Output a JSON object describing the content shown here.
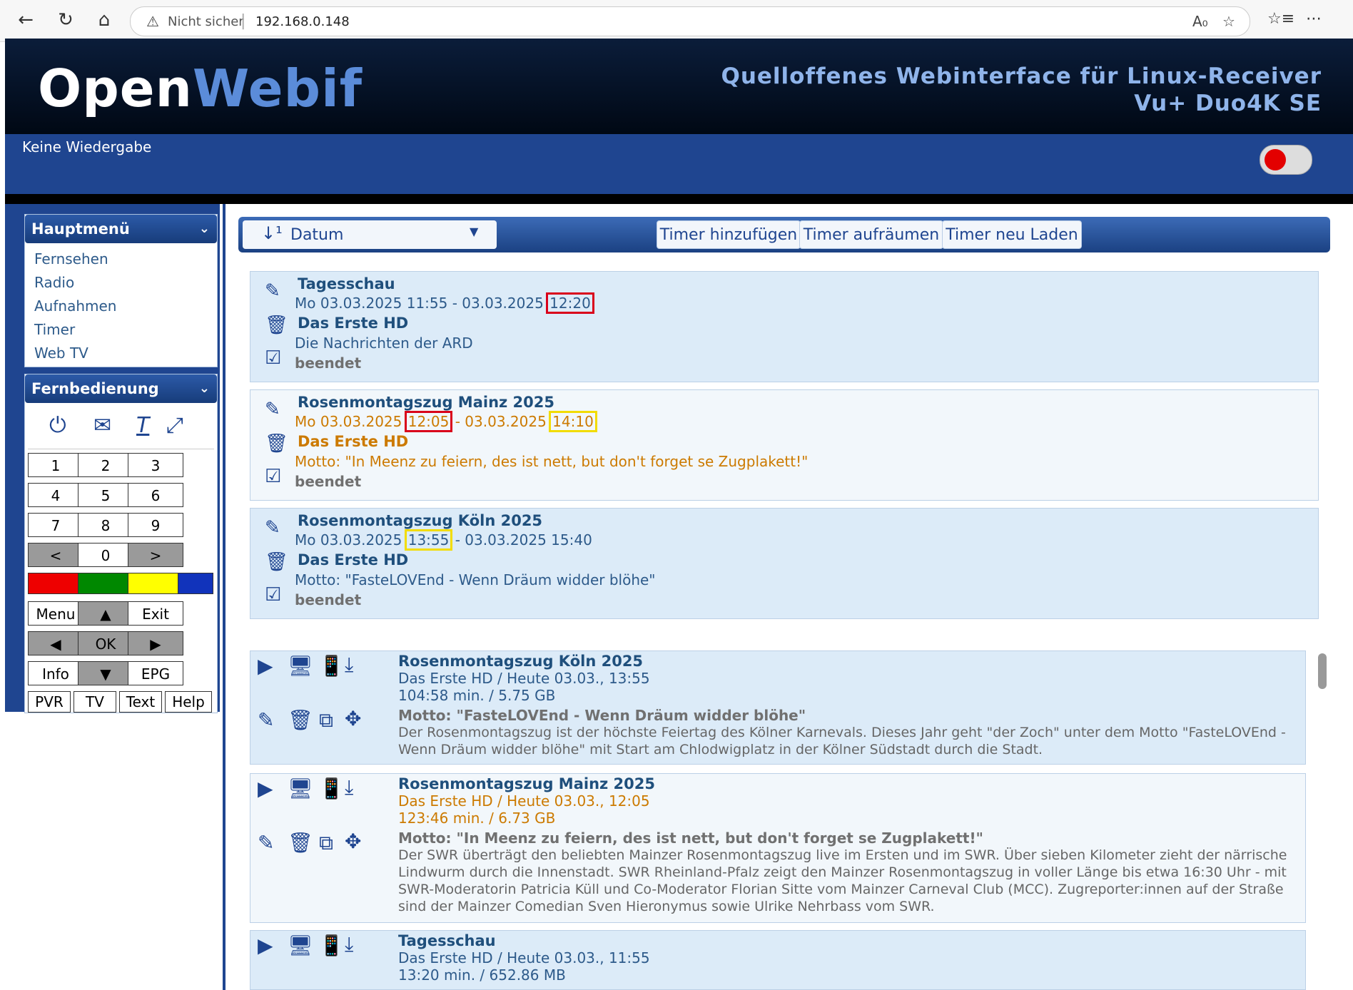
{
  "browser": {
    "warning": "Nicht sicher",
    "url": "192.168.0.148"
  },
  "header": {
    "logo_open": "Open",
    "logo_webif": "Webif",
    "tagline_1": "Quelloffenes Webinterface für Linux-Receiver",
    "tagline_2": "Vu+ Duo4K SE",
    "playback": "Keine Wiedergabe"
  },
  "sidebar": {
    "main_menu_title": "Hauptmenü",
    "main_menu": [
      "Fernsehen",
      "Radio",
      "Aufnahmen",
      "Timer",
      "Web TV"
    ],
    "remote_title": "Fernbedienung",
    "remote_keys": {
      "k1": "1",
      "k2": "2",
      "k3": "3",
      "k4": "4",
      "k5": "5",
      "k6": "6",
      "k7": "7",
      "k8": "8",
      "k9": "9",
      "prev": "<",
      "k0": "0",
      "next": ">",
      "menu": "Menu",
      "up": "▲",
      "exit": "Exit",
      "left": "◀",
      "ok": "OK",
      "right": "▶",
      "info": "Info",
      "down": "▼",
      "epg": "EPG",
      "pvr": "PVR",
      "tv": "TV",
      "text": "Text",
      "help": "Help"
    },
    "color_keys": [
      "#ee0000",
      "#008800",
      "#ffff00",
      "#1133bb"
    ]
  },
  "toolbar": {
    "sort_label": "Datum",
    "add": "Timer hinzufügen",
    "cleanup": "Timer aufräumen",
    "reload": "Timer neu Laden"
  },
  "timers": [
    {
      "title": "Tagesschau",
      "time_prefix": "Mo 03.03.2025 11:55 - 03.03.2025 ",
      "time_end": "12:20",
      "channel": "Das Erste HD",
      "desc": "Die Nachrichten der ARD",
      "status": "beendet"
    },
    {
      "title": "Rosenmontagszug Mainz 2025",
      "time_a": "Mo 03.03.2025 ",
      "time_start": "12:05",
      "time_b": " - 03.03.2025 ",
      "time_end": "14:10",
      "channel": "Das Erste HD",
      "desc": "Motto: \"In Meenz zu feiern, des ist nett, but don't forget se Zugplakett!\"",
      "status": "beendet"
    },
    {
      "title": "Rosenmontagszug Köln 2025",
      "time_a": "Mo 03.03.2025 ",
      "time_start": "13:55",
      "time_b": " - 03.03.2025 15:40",
      "channel": "Das Erste HD",
      "desc": "Motto: \"FasteLOVEnd - Wenn Dräum widder blöhe\"",
      "status": "beendet"
    }
  ],
  "recordings": [
    {
      "title": "Rosenmontagszug Köln 2025",
      "line1": "Das Erste HD / Heute 03.03., 13:55",
      "line2": "104:58 min. / 5.75 GB",
      "motto": "Motto: \"FasteLOVEnd - Wenn Dräum widder blöhe\"",
      "body": "Der Rosenmontagszug ist der höchste Feiertag des Kölner Karnevals. Dieses Jahr geht \"der Zoch\" unter dem Motto \"FasteLOVEnd - Wenn Dräum widder blöhe\" mit Start am Chlodwigplatz in der Kölner Südstadt durch die Stadt."
    },
    {
      "title": "Rosenmontagszug Mainz 2025",
      "line1": "Das Erste HD / Heute 03.03., 12:05",
      "line2": "123:46 min. / 6.73 GB",
      "motto": "Motto: \"In Meenz zu feiern, des ist nett, but don't forget se Zugplakett!\"",
      "body": "Der SWR überträgt den beliebten Mainzer Rosenmontagszug live im Ersten und im SWR. Über sieben Kilometer zieht der närrische Lindwurm durch die Innenstadt. SWR Rheinland-Pfalz zeigt den Mainzer Rosenmontagszug in voller Länge bis etwa 16:30 Uhr - mit SWR-Moderatorin Patricia Küll und Co-Moderator Florian Sitte vom Mainzer Carneval Club (MCC). Zugreporter:innen auf der Straße sind der Mainzer Comedian Sven Hieronymus sowie Ulrike Nehrbass vom SWR."
    },
    {
      "title": "Tagesschau",
      "line1": "Das Erste HD / Heute 03.03., 11:55",
      "line2": "13:20 min. / 652.86 MB"
    }
  ]
}
